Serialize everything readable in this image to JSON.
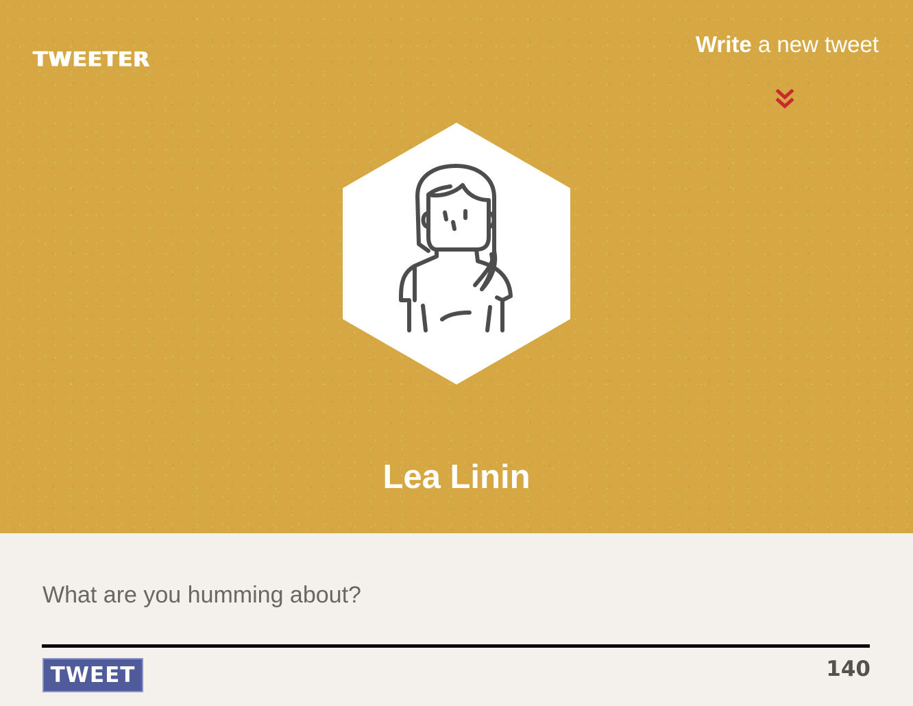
{
  "header": {
    "logo_text": "TWEETER",
    "write_link": {
      "bold": "Write",
      "rest": " a new tweet"
    },
    "chevron_icon": "double-chevron-down-icon",
    "chevron_color": "#c8282f"
  },
  "profile": {
    "name": "Lea Linin",
    "avatar_icon": "woman-avatar-icon",
    "background_color": "#d5a843"
  },
  "composer": {
    "placeholder": "What are you humming about?",
    "value": "",
    "submit_label": "TWEET",
    "char_count": "140",
    "button_color": "#4f5b9a"
  }
}
